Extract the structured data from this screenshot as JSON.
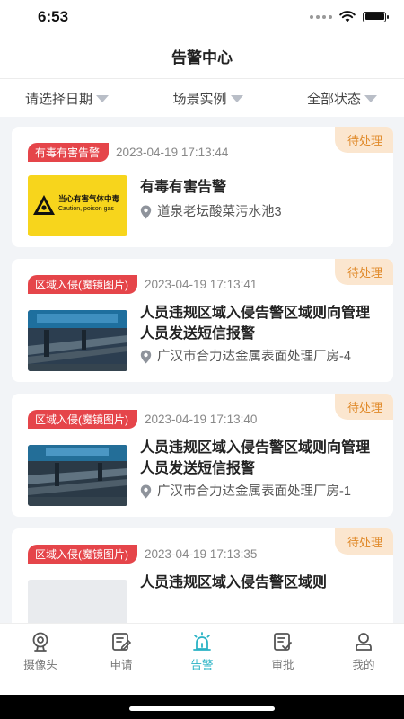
{
  "status_bar": {
    "time": "6:53"
  },
  "navbar": {
    "title": "告警中心"
  },
  "filters": [
    {
      "label": "请选择日期"
    },
    {
      "label": "场景实例"
    },
    {
      "label": "全部状态"
    }
  ],
  "alarms": [
    {
      "status": "待处理",
      "type": "有毒有害告警",
      "time": "2023-04-19 17:13:44",
      "title": "有毒有害告警",
      "location": "道泉老坛酸菜污水池3",
      "image": {
        "kind": "poison-sign",
        "sign_text": "当心有害气体中毒",
        "sign_subtext": "Caution, poison gas"
      }
    },
    {
      "status": "待处理",
      "type": "区域入侵(魔镜图片)",
      "time": "2023-04-19 17:13:41",
      "title": "人员违规区域入侵告警区域则向管理人员发送短信报警",
      "location": "广汉市合力达金属表面处理厂房-4",
      "image": {
        "kind": "factory-photo"
      }
    },
    {
      "status": "待处理",
      "type": "区域入侵(魔镜图片)",
      "time": "2023-04-19 17:13:40",
      "title": "人员违规区域入侵告警区域则向管理人员发送短信报警",
      "location": "广汉市合力达金属表面处理厂房-1",
      "image": {
        "kind": "factory-photo"
      }
    },
    {
      "status": "待处理",
      "type": "区域入侵(魔镜图片)",
      "time": "2023-04-19 17:13:35",
      "title": "人员违规区域入侵告警区域则",
      "location": "",
      "image": {
        "kind": "placeholder"
      }
    }
  ],
  "tabbar": [
    {
      "label": "摄像头",
      "icon": "camera-icon"
    },
    {
      "label": "申请",
      "icon": "apply-icon"
    },
    {
      "label": "告警",
      "icon": "alarm-icon",
      "active": true
    },
    {
      "label": "审批",
      "icon": "approve-icon"
    },
    {
      "label": "我的",
      "icon": "user-icon"
    }
  ],
  "colors": {
    "accent": "#2ab3c5",
    "type_tag": "#e5454a",
    "status_bg": "#fbe6cf",
    "status_text": "#e08a2a"
  }
}
